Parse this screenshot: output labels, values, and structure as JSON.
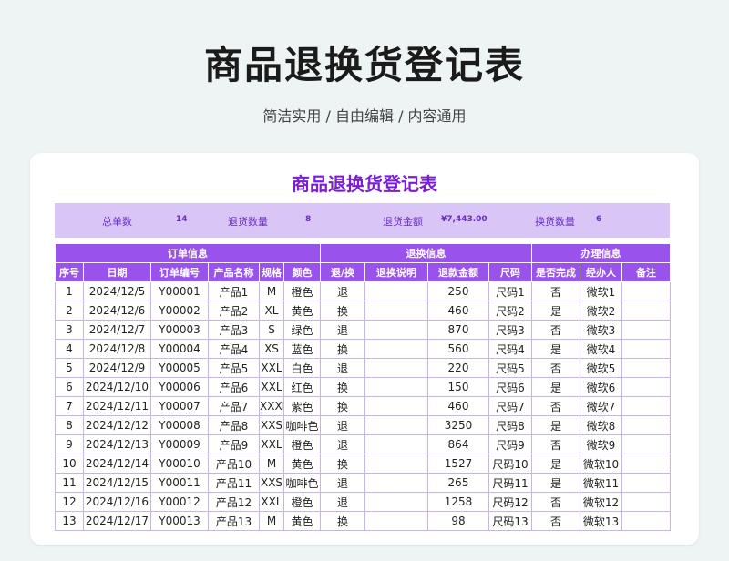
{
  "page": {
    "title": "商品退换货登记表",
    "subtitle": "简洁实用 / 自由编辑 / 内容通用"
  },
  "sheet": {
    "title": "商品退换货登记表",
    "summary": {
      "total_orders_label": "总单数",
      "total_orders_value": "14",
      "return_qty_label": "退货数量",
      "return_qty_value": "8",
      "return_amount_label": "退货金额",
      "return_amount_value": "¥7,443.00",
      "exchange_qty_label": "换货数量",
      "exchange_qty_value": "6"
    },
    "group_headers": {
      "order": "订单信息",
      "return": "退换信息",
      "handle": "办理信息"
    },
    "columns": [
      "序号",
      "日期",
      "订单编号",
      "产品名称",
      "规格",
      "颜色",
      "退/换",
      "退换说明",
      "退款金额",
      "尺码",
      "是否完成",
      "经办人",
      "备注"
    ],
    "rows": [
      [
        "1",
        "2024/12/5",
        "Y00001",
        "产品1",
        "M",
        "橙色",
        "退",
        "",
        "250",
        "尺码1",
        "否",
        "微软1",
        ""
      ],
      [
        "2",
        "2024/12/6",
        "Y00002",
        "产品2",
        "XL",
        "黄色",
        "换",
        "",
        "460",
        "尺码2",
        "是",
        "微软2",
        ""
      ],
      [
        "3",
        "2024/12/7",
        "Y00003",
        "产品3",
        "S",
        "绿色",
        "退",
        "",
        "870",
        "尺码3",
        "否",
        "微软3",
        ""
      ],
      [
        "4",
        "2024/12/8",
        "Y00004",
        "产品4",
        "XS",
        "蓝色",
        "换",
        "",
        "560",
        "尺码4",
        "是",
        "微软4",
        ""
      ],
      [
        "5",
        "2024/12/9",
        "Y00005",
        "产品5",
        "XXL",
        "白色",
        "退",
        "",
        "220",
        "尺码5",
        "否",
        "微软5",
        ""
      ],
      [
        "6",
        "2024/12/10",
        "Y00006",
        "产品6",
        "XXL",
        "红色",
        "换",
        "",
        "150",
        "尺码6",
        "是",
        "微软6",
        ""
      ],
      [
        "7",
        "2024/12/11",
        "Y00007",
        "产品7",
        "XXXL",
        "紫色",
        "换",
        "",
        "460",
        "尺码7",
        "否",
        "微软7",
        ""
      ],
      [
        "8",
        "2024/12/12",
        "Y00008",
        "产品8",
        "XXS",
        "咖啡色",
        "退",
        "",
        "3250",
        "尺码8",
        "是",
        "微软8",
        ""
      ],
      [
        "9",
        "2024/12/13",
        "Y00009",
        "产品9",
        "XXL",
        "橙色",
        "退",
        "",
        "864",
        "尺码9",
        "否",
        "微软9",
        ""
      ],
      [
        "10",
        "2024/12/14",
        "Y00010",
        "产品10",
        "M",
        "黄色",
        "换",
        "",
        "1527",
        "尺码10",
        "是",
        "微软10",
        ""
      ],
      [
        "11",
        "2024/12/15",
        "Y00011",
        "产品11",
        "XXS",
        "咖啡色",
        "退",
        "",
        "265",
        "尺码11",
        "是",
        "微软11",
        ""
      ],
      [
        "12",
        "2024/12/16",
        "Y00012",
        "产品12",
        "XXL",
        "橙色",
        "退",
        "",
        "1258",
        "尺码12",
        "否",
        "微软12",
        ""
      ],
      [
        "13",
        "2024/12/17",
        "Y00013",
        "产品13",
        "M",
        "黄色",
        "换",
        "",
        "98",
        "尺码13",
        "否",
        "微软13",
        ""
      ]
    ],
    "colors": {
      "header_bg": "#9a52ec",
      "summary_bg": "#d9c6f7",
      "title_color": "#7a1fd6",
      "grid_border": "#c9b2ee"
    }
  }
}
